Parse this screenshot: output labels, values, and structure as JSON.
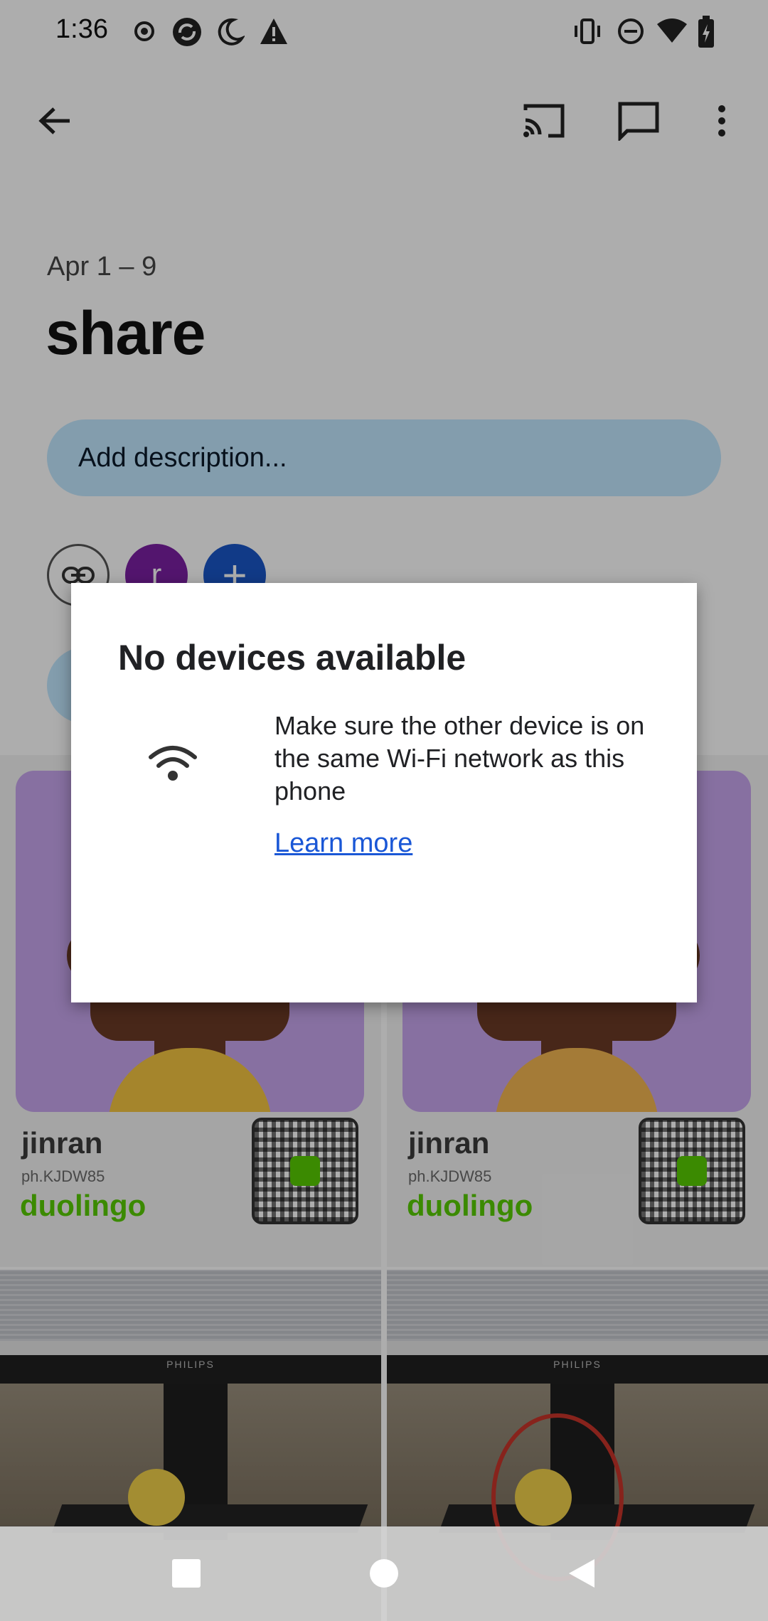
{
  "status_bar": {
    "time": "1:36",
    "left_icons": [
      "record-icon",
      "sync-icon",
      "do-not-disturb-moon-icon",
      "warning-icon"
    ],
    "right_icons": [
      "vibrate-icon",
      "do-not-disturb-icon",
      "wifi-icon",
      "battery-charging-icon"
    ]
  },
  "app_bar": {
    "actions": [
      "back-arrow-icon",
      "cast-icon",
      "comment-icon",
      "more-vert-icon"
    ]
  },
  "album": {
    "date_range": "Apr 1 – 9",
    "title": "share",
    "description_placeholder": "Add description...",
    "avatar_initial": "r",
    "add_symbol": "+"
  },
  "photos": [
    {
      "type": "profile-card",
      "name": "jinran",
      "username": "ph.KJDW85",
      "brand": "duolingo"
    },
    {
      "type": "profile-card",
      "name": "jinran",
      "username": "ph.KJDW85",
      "brand": "duolingo"
    },
    {
      "type": "desk-photo",
      "monitor_brand": "PHILIPS"
    },
    {
      "type": "desk-photo",
      "monitor_brand": "PHILIPS"
    }
  ],
  "dialog": {
    "title": "No devices available",
    "icon": "wifi-icon",
    "message": "Make sure the other device is on the same Wi-Fi network as this phone",
    "link": "Learn more"
  },
  "nav_bar": {
    "buttons": [
      "recents-square-icon",
      "home-circle-icon",
      "back-triangle-icon"
    ]
  },
  "colors": {
    "accent_pill": "#c2e7ff",
    "avatar": "#7b1fa2",
    "add_button": "#1a56c8",
    "link": "#1a57d6",
    "duolingo_green": "#58cc02",
    "card_art": "#c8a6ee"
  }
}
